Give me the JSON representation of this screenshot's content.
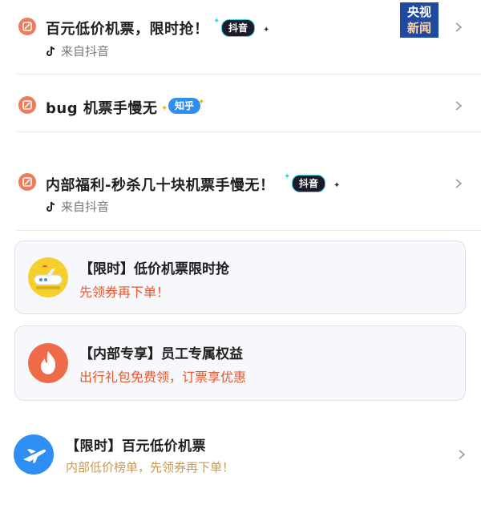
{
  "items": [
    {
      "title": "百元低价机票，限时抢！",
      "tag": "抖音",
      "source": "来自抖音"
    },
    {
      "title": "bug 机票手慢无",
      "tag": "知乎"
    },
    {
      "title": "内部福利-秒杀几十块机票手慢无！",
      "tag": "抖音",
      "source": "来自抖音"
    }
  ],
  "cards": [
    {
      "title": "【限时】低价机票限时抢",
      "subtitle": "先领券再下单！"
    },
    {
      "title": "【内部专享】员工专属权益",
      "subtitle": "出行礼包免费领，订票享优惠"
    }
  ],
  "promo": {
    "title": "【限时】百元低价机票",
    "subtitle": "内部低价榜单，先领券再下单！"
  },
  "watermark": {
    "line1": "央视",
    "line2": "新闻"
  },
  "colors": {
    "accent_orange": "#e8562a",
    "coupon_icon": "#f07a5a",
    "douyin_tag_border": "#33d6e6",
    "zhihu_blue": "#2f8ef4",
    "watermark_blue": "#1f4aa0"
  }
}
